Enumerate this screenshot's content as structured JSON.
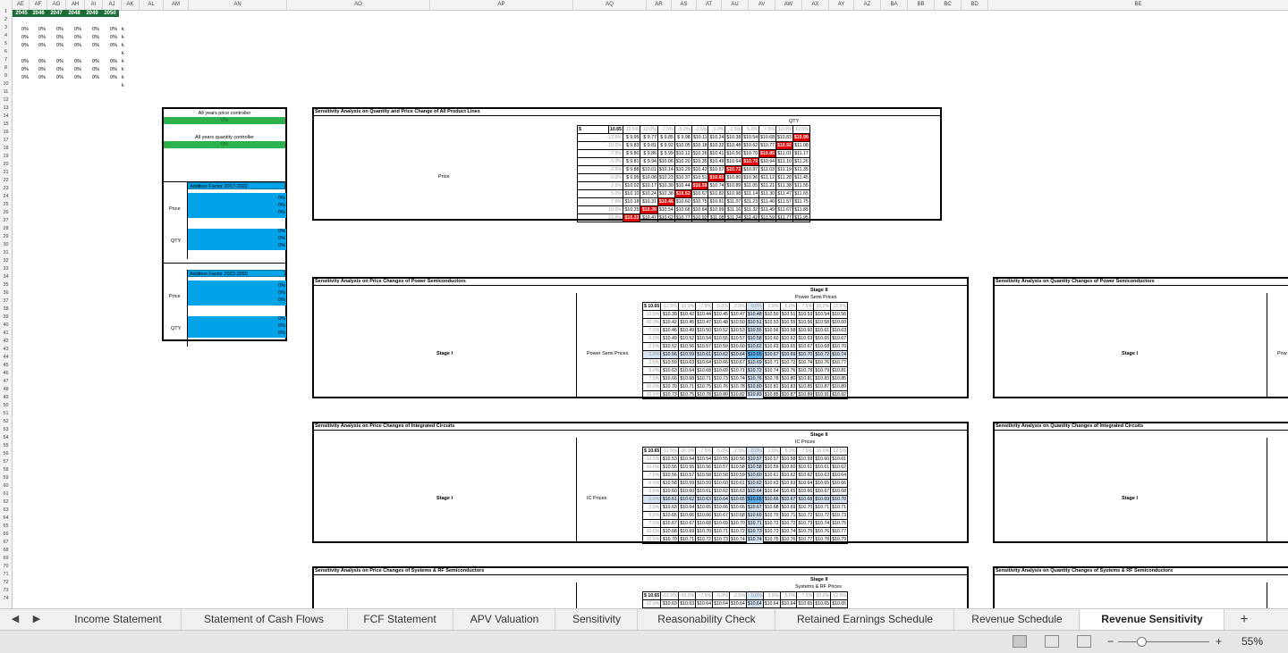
{
  "column_headers": [
    "AE",
    "AF",
    "AG",
    "AH",
    "AI",
    "AJ",
    "AK",
    "AL",
    "AM",
    "AN",
    "AO",
    "AP",
    "AQ",
    "AR",
    "AS",
    "AT",
    "AU",
    "AV",
    "AW",
    "AX",
    "AY",
    "AZ",
    "BA",
    "BB",
    "BC",
    "BD",
    "BE"
  ],
  "years": [
    "2045",
    "2046",
    "2047",
    "2048",
    "2049",
    "2050"
  ],
  "top_percents": [
    "0%",
    "0%",
    "0%",
    "0%",
    "0%",
    "0%"
  ],
  "k_marker": "k",
  "controller": {
    "price_title": "All years price controller",
    "price_value": "0%",
    "qty_title": "All years quantity controller",
    "qty_value": "0%",
    "factor_1_title": "Addition Factor 2017-2022",
    "factor_2_title": "Addition Factor 2023-2050",
    "price_label": "Price",
    "qty_label": "QTY",
    "zero": "0%"
  },
  "main_table": {
    "title": "Sensitivity Analysis on Quantity and Price Change of All Product Lines",
    "qty_header": "QTY",
    "price_label": "Price",
    "corner_symbol": "$",
    "corner_value": "10.65",
    "col_headers": [
      "-12.5%",
      "-10.0%",
      "-7.5%",
      "-5.0%",
      "-2.5%",
      "0.0%",
      "2.5%",
      "5.0%",
      "7.5%",
      "10.0%",
      "12.5%"
    ],
    "row_headers": [
      "-12.5%",
      "-10.0%",
      "-7.5%",
      "-5.0%",
      "-2.5%",
      "0.0%",
      "2.5%",
      "5.0%",
      "7.5%",
      "10.0%",
      "12.5%"
    ],
    "rows": [
      [
        "$ 9.95",
        "$ 9.77",
        "$ 9.85",
        "$ 9.98",
        "$10.11",
        "$10.24",
        "$10.38",
        "$10.54",
        "$10.68",
        "$10.83",
        "$10.99"
      ],
      [
        "$ 9.83",
        "$ 9.81",
        "$ 9.92",
        "$10.05",
        "$10.18",
        "$10.32",
        "$10.48",
        "$10.62",
        "$10.77",
        "$10.92",
        "$11.08"
      ],
      [
        "$ 9.80",
        "$ 9.86",
        "$ 9.99",
        "$10.12",
        "$10.26",
        "$10.41",
        "$10.56",
        "$10.70",
        "$10.85",
        "$11.01",
        "$11.17"
      ],
      [
        "$ 9.81",
        "$ 9.94",
        "$10.06",
        "$10.20",
        "$10.35",
        "$10.49",
        "$10.64",
        "$10.79",
        "$10.94",
        "$11.10",
        "$11.26"
      ],
      [
        "$ 9.88",
        "$10.01",
        "$10.14",
        "$10.29",
        "$10.43",
        "$10.57",
        "$10.72",
        "$10.87",
        "$11.03",
        "$11.19",
        "$11.35"
      ],
      [
        "$ 9.95",
        "$10.08",
        "$10.23",
        "$10.37",
        "$10.51",
        "$10.65",
        "$10.80",
        "$10.96",
        "$11.12",
        "$11.28",
        "$11.45"
      ],
      [
        "$10.02",
        "$10.17",
        "$10.30",
        "$10.44",
        "$10.59",
        "$10.74",
        "$10.89",
        "$11.05",
        "$11.21",
        "$11.38",
        "$11.55"
      ],
      [
        "$10.10",
        "$10.24",
        "$10.38",
        "$10.52",
        "$10.67",
        "$10.82",
        "$10.98",
        "$11.14",
        "$11.30",
        "$11.47",
        "$11.65"
      ],
      [
        "$10.18",
        "$10.31",
        "$10.46",
        "$10.60",
        "$10.75",
        "$10.91",
        "$11.07",
        "$11.23",
        "$11.40",
        "$11.57",
        "$11.75"
      ],
      [
        "$10.25",
        "$10.39",
        "$10.54",
        "$10.68",
        "$10.84",
        "$10.99",
        "$11.16",
        "$11.32",
        "$11.49",
        "$11.67",
        "$11.85"
      ],
      [
        "$10.33",
        "$10.47",
        "$10.62",
        "$10.77",
        "$10.92",
        "$11.08",
        "$11.24",
        "$11.42",
        "$11.59",
        "$11.77",
        "$11.95"
      ]
    ]
  },
  "stage_tables": [
    {
      "title": "Sensitivity Analysis on Price Changes of Power Semiconductors",
      "stage_ii": "Stage II",
      "sub_header": "Power Semi Prices",
      "stage_i": "Stage I",
      "side_label": "Power Semi Prices",
      "corner": "$ 10.65",
      "col_headers": [
        "-12.5%",
        "-10.0%",
        "-7.5%",
        "-5.0%",
        "-2.5%",
        "0.0%",
        "2.5%",
        "5.0%",
        "7.5%",
        "10.0%",
        "12.5%"
      ],
      "row_headers": [
        "-12.5%",
        "-10.0%",
        "-7.5%",
        "-5.0%",
        "-2.5%",
        "0.0%",
        "2.5%",
        "5.0%",
        "7.5%",
        "10.0%",
        "12.5%"
      ],
      "rows": [
        [
          "$10.39",
          "$10.42",
          "$10.44",
          "$10.45",
          "$10.47",
          "$10.48",
          "$10.50",
          "$10.51",
          "$10.53",
          "$10.54",
          "$10.56"
        ],
        [
          "$10.42",
          "$10.45",
          "$10.47",
          "$10.48",
          "$10.50",
          "$10.51",
          "$10.53",
          "$10.55",
          "$10.56",
          "$10.58",
          "$10.60"
        ],
        [
          "$10.46",
          "$10.49",
          "$10.50",
          "$10.52",
          "$10.53",
          "$10.55",
          "$10.56",
          "$10.58",
          "$10.60",
          "$10.61",
          "$10.63"
        ],
        [
          "$10.49",
          "$10.52",
          "$10.54",
          "$10.55",
          "$10.57",
          "$10.58",
          "$10.60",
          "$10.62",
          "$10.63",
          "$10.65",
          "$10.67"
        ],
        [
          "$10.52",
          "$10.56",
          "$10.57",
          "$10.59",
          "$10.60",
          "$10.62",
          "$10.63",
          "$10.65",
          "$10.67",
          "$10.68",
          "$10.70"
        ],
        [
          "$10.56",
          "$10.59",
          "$10.61",
          "$10.62",
          "$10.64",
          "$10.65",
          "$10.67",
          "$10.69",
          "$10.70",
          "$10.72",
          "$10.74"
        ],
        [
          "$10.59",
          "$10.63",
          "$10.64",
          "$10.66",
          "$10.67",
          "$10.69",
          "$10.71",
          "$10.72",
          "$10.74",
          "$10.76",
          "$10.77"
        ],
        [
          "$10.63",
          "$10.64",
          "$10.68",
          "$10.69",
          "$10.71",
          "$10.72",
          "$10.74",
          "$10.76",
          "$10.78",
          "$10.79",
          "$10.81"
        ],
        [
          "$10.66",
          "$10.68",
          "$10.71",
          "$10.73",
          "$10.74",
          "$10.76",
          "$10.78",
          "$10.80",
          "$10.81",
          "$10.83",
          "$10.85"
        ],
        [
          "$10.70",
          "$10.71",
          "$10.75",
          "$10.76",
          "$10.78",
          "$10.80",
          "$10.81",
          "$10.83",
          "$10.85",
          "$10.87",
          "$10.89"
        ],
        [
          "$10.73",
          "$10.75",
          "$10.78",
          "$10.80",
          "$10.82",
          "$10.83",
          "$10.85",
          "$10.87",
          "$10.89",
          "$10.91",
          "$10.92"
        ]
      ]
    },
    {
      "title": "Sensitivity Analysis on Price Changes of Integrated Circuits",
      "stage_ii": "Stage II",
      "sub_header": "IC Prices",
      "stage_i": "Stage I",
      "side_label": "IC Prices",
      "corner": "$ 10.65",
      "col_headers": [
        "-12.5%",
        "-10.0%",
        "-7.5%",
        "-5.0%",
        "-2.5%",
        "0.0%",
        "2.5%",
        "5.0%",
        "7.5%",
        "10.0%",
        "12.5%"
      ],
      "row_headers": [
        "-12.5%",
        "-10.0%",
        "-7.5%",
        "-5.0%",
        "-2.5%",
        "0.0%",
        "2.5%",
        "5.0%",
        "7.5%",
        "10.0%",
        "12.5%"
      ],
      "rows": [
        [
          "$10.53",
          "$10.54",
          "$10.54",
          "$10.55",
          "$10.56",
          "$10.57",
          "$10.57",
          "$10.58",
          "$10.59",
          "$10.60",
          "$10.61"
        ],
        [
          "$10.55",
          "$10.55",
          "$10.56",
          "$10.57",
          "$10.58",
          "$10.58",
          "$10.59",
          "$10.60",
          "$10.61",
          "$10.61",
          "$10.62"
        ],
        [
          "$10.56",
          "$10.57",
          "$10.58",
          "$10.58",
          "$10.59",
          "$10.60",
          "$10.61",
          "$10.62",
          "$10.62",
          "$10.63",
          "$10.64"
        ],
        [
          "$10.58",
          "$10.59",
          "$10.59",
          "$10.60",
          "$10.61",
          "$10.62",
          "$10.63",
          "$10.63",
          "$10.64",
          "$10.65",
          "$10.66"
        ],
        [
          "$10.60",
          "$10.60",
          "$10.61",
          "$10.62",
          "$10.63",
          "$10.64",
          "$10.64",
          "$10.65",
          "$10.66",
          "$10.67",
          "$10.68"
        ],
        [
          "$10.61",
          "$10.62",
          "$10.63",
          "$10.64",
          "$10.65",
          "$10.65",
          "$10.66",
          "$10.67",
          "$10.68",
          "$10.69",
          "$10.70"
        ],
        [
          "$10.63",
          "$10.64",
          "$10.65",
          "$10.66",
          "$10.66",
          "$10.67",
          "$10.68",
          "$10.69",
          "$10.70",
          "$10.71",
          "$10.71"
        ],
        [
          "$10.65",
          "$10.66",
          "$10.66",
          "$10.67",
          "$10.68",
          "$10.69",
          "$10.70",
          "$10.71",
          "$10.72",
          "$10.72",
          "$10.73"
        ],
        [
          "$10.67",
          "$10.67",
          "$10.68",
          "$10.69",
          "$10.70",
          "$10.71",
          "$10.72",
          "$10.72",
          "$10.73",
          "$10.74",
          "$10.75"
        ],
        [
          "$10.68",
          "$10.69",
          "$10.70",
          "$10.71",
          "$10.72",
          "$10.73",
          "$10.73",
          "$10.74",
          "$10.75",
          "$10.76",
          "$10.77"
        ],
        [
          "$10.70",
          "$10.71",
          "$10.72",
          "$10.73",
          "$10.74",
          "$10.74",
          "$10.75",
          "$10.76",
          "$10.77",
          "$10.78",
          "$10.79"
        ]
      ]
    },
    {
      "title": "Sensitivity Analysis on Price Changes of Systems & RF Semiconductors",
      "stage_ii": "Stage II",
      "sub_header": "Systems & RF Prices",
      "corner": "$ 10.65",
      "col_headers": [
        "-12.5%",
        "-10.0%",
        "-7.5%",
        "-5.0%",
        "-2.5%",
        "0.0%",
        "2.5%",
        "5.0%",
        "7.5%",
        "10.0%",
        "12.5%"
      ],
      "row_headers": [
        "-12.5%"
      ],
      "rows": [
        [
          "$10.63",
          "$10.63",
          "$10.64",
          "$10.64",
          "$10.64",
          "$10.64",
          "$10.64",
          "$10.64",
          "$10.65",
          "$10.65",
          "$10.65"
        ]
      ]
    }
  ],
  "right_panels": [
    {
      "title": "Sensitivity Analysis on Quantity Changes of Power Semiconductors",
      "stage_i": "Stage I",
      "cut_label": "Pow"
    },
    {
      "title": "Sensitivity Analysis on Quantity Changes of Integrated Circuits",
      "stage_i": "Stage I"
    },
    {
      "title": "Sensitivity Analysis on Quantity Changes of Systems & RF Semiconductors"
    }
  ],
  "tabs": [
    {
      "label": "Income Statement"
    },
    {
      "label": "Statement of Cash Flows"
    },
    {
      "label": "FCF Statement"
    },
    {
      "label": "APV Valuation"
    },
    {
      "label": "Sensitivity"
    },
    {
      "label": "Reasonability Check"
    },
    {
      "label": "Retained Earnings Schedule"
    },
    {
      "label": "Revenue Schedule"
    },
    {
      "label": "Revenue Sensitivity",
      "active": true
    }
  ],
  "add_sheet": "+",
  "zoom": {
    "percent": "55%",
    "minus": "−",
    "plus": "+",
    "level": 0.55
  },
  "colors": {
    "accent_green": "#1e6b3a",
    "red_highlight": "#e00000",
    "blue_input": "#00a2e8"
  }
}
